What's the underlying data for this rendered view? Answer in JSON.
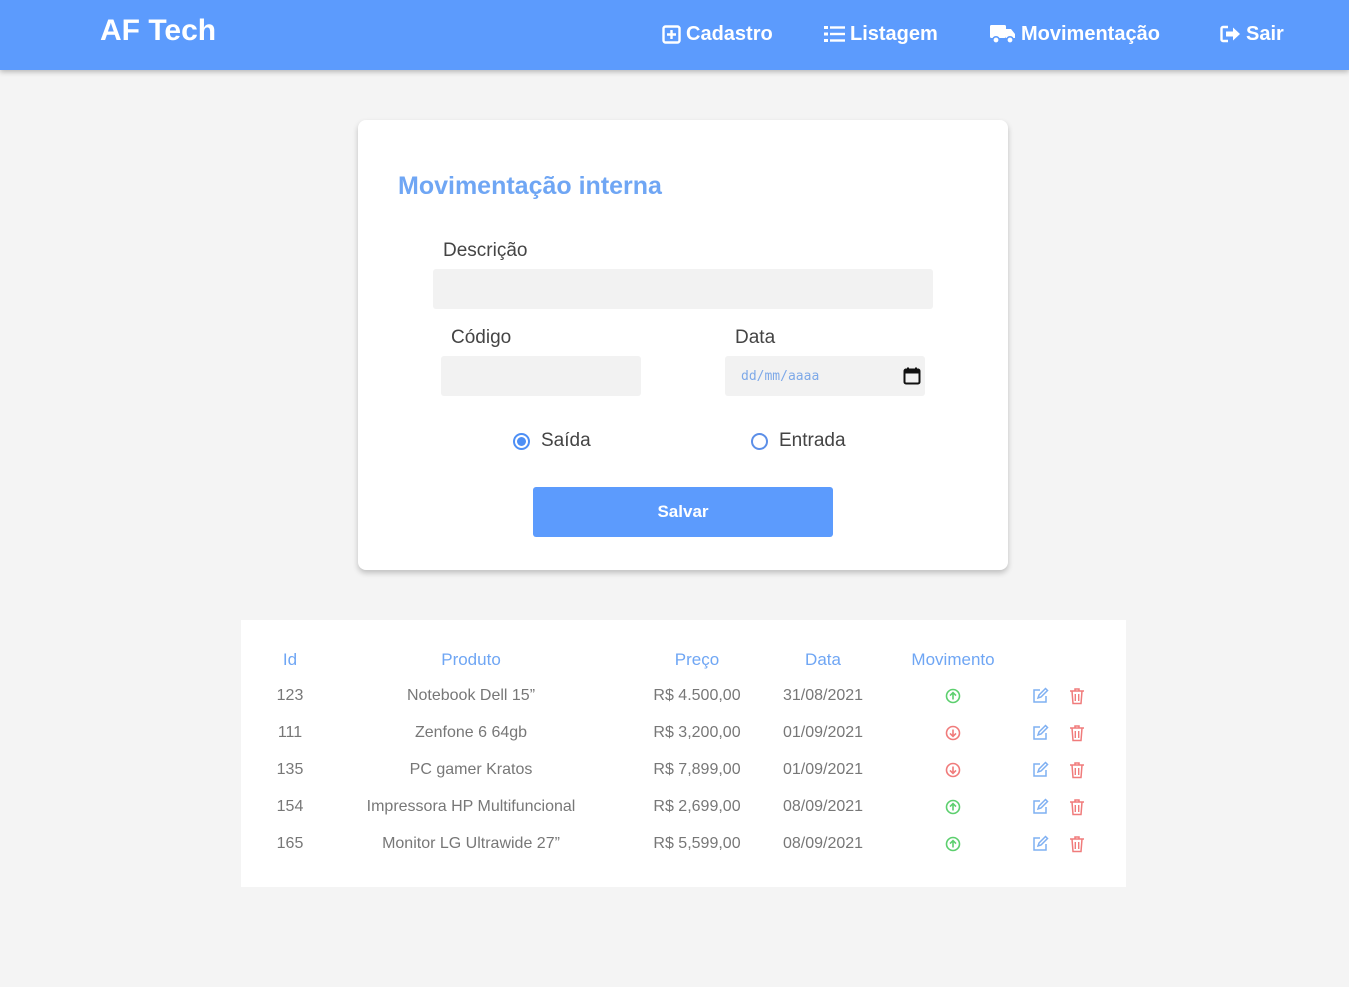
{
  "nav": {
    "brand": "AF Tech",
    "links": [
      {
        "label": "Cadastro",
        "icon": "plus-square-icon"
      },
      {
        "label": "Listagem",
        "icon": "list-icon"
      },
      {
        "label": "Movimentação",
        "icon": "truck-icon"
      },
      {
        "label": "Sair",
        "icon": "sign-out-icon"
      }
    ]
  },
  "form": {
    "title": "Movimentação interna",
    "descricao_label": "Descrição",
    "descricao_value": "",
    "codigo_label": "Código",
    "codigo_value": "",
    "data_label": "Data",
    "data_placeholder": "dd/mm/aaaa",
    "radio_saida": "Saída",
    "radio_entrada": "Entrada",
    "selected": "Saída",
    "save_label": "Salvar"
  },
  "table": {
    "headers": [
      "Id",
      "Produto",
      "Preço",
      "Data",
      "Movimento"
    ],
    "rows": [
      {
        "id": "123",
        "produto": "Notebook Dell 15”",
        "preco": "R$ 4.500,00",
        "data": "31/08/2021",
        "movimento": "up"
      },
      {
        "id": "111",
        "produto": "Zenfone 6 64gb",
        "preco": "R$ 3,200,00",
        "data": "01/09/2021",
        "movimento": "down"
      },
      {
        "id": "135",
        "produto": "PC gamer Kratos",
        "preco": "R$ 7,899,00",
        "data": "01/09/2021",
        "movimento": "down"
      },
      {
        "id": "154",
        "produto": "Impressora HP Multifuncional",
        "preco": "R$ 2,699,00",
        "data": "08/09/2021",
        "movimento": "up"
      },
      {
        "id": "165",
        "produto": "Monitor LG Ultrawide 27”",
        "preco": "R$ 5,599,00",
        "data": "08/09/2021",
        "movimento": "up"
      }
    ]
  },
  "colors": {
    "primary": "#5c9bfd",
    "title": "#6fa6f4",
    "up": "#5ccf6e",
    "down": "#f07b7b",
    "edit": "#7fb0f2",
    "delete": "#f07b7b",
    "background": "#f4f4f4"
  }
}
